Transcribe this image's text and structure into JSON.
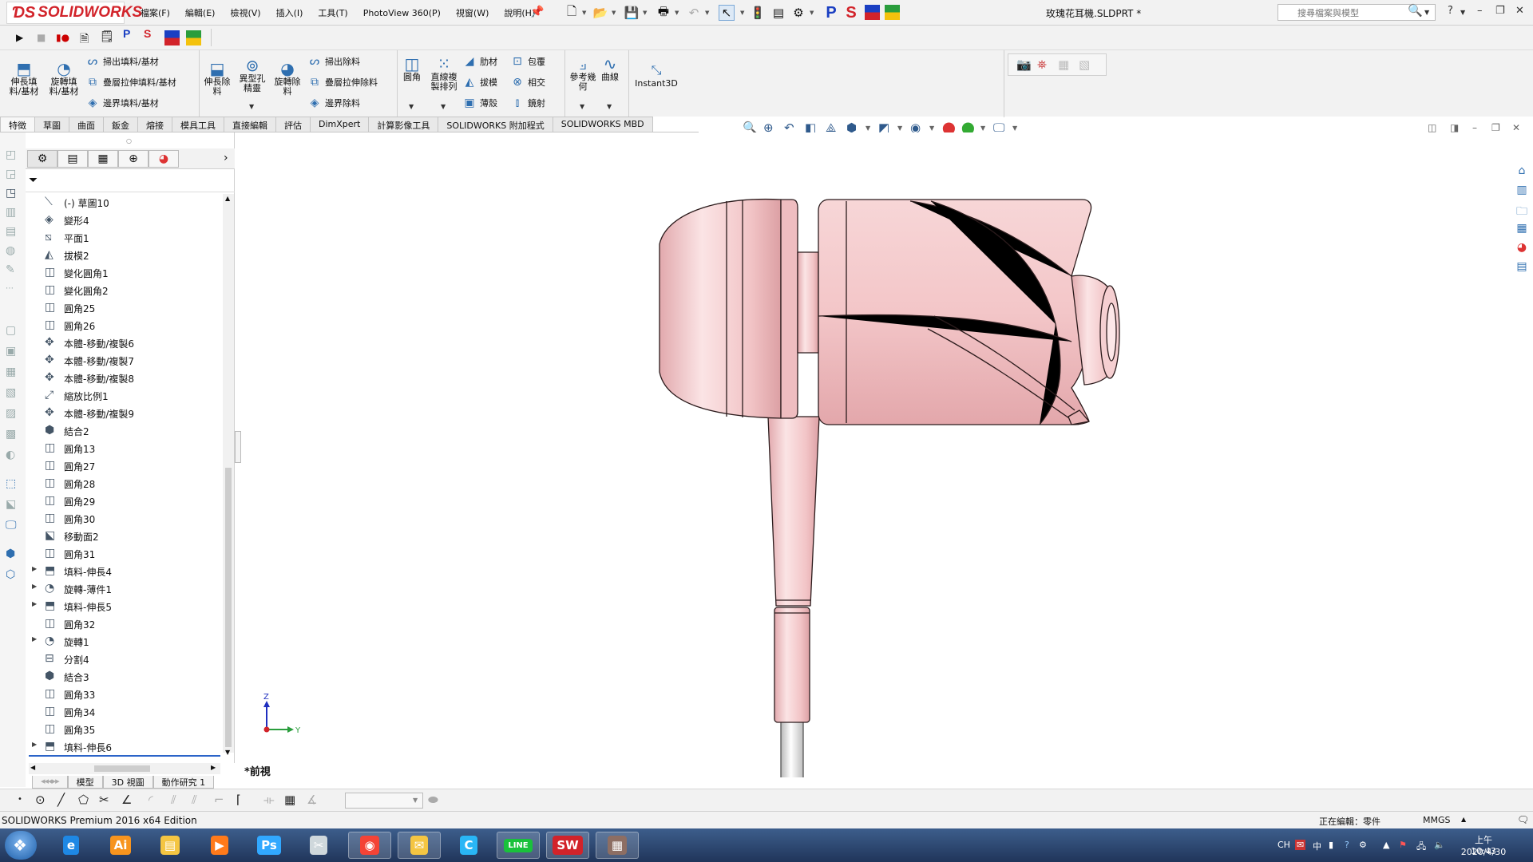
{
  "app": {
    "logo_text": "SOLIDWORKS",
    "document_title": "玫瑰花耳機.SLDPRT *",
    "search_placeholder": "搜尋檔案與模型"
  },
  "menu": [
    "檔案(F)",
    "編輯(E)",
    "檢視(V)",
    "插入(I)",
    "工具(T)",
    "PhotoView 360(P)",
    "視窗(W)",
    "說明(H)"
  ],
  "macro_bar": {
    "p_label": "P",
    "s_label": "S"
  },
  "command_manager": {
    "features": {
      "extruded_boss": "伸長填\n料/基材",
      "revolved_boss": "旋轉填\n料/基材",
      "swept_boss": "掃出填料/基材",
      "lofted_boss": "疊層拉伸填料/基材",
      "boundary_boss": "邊界填料/基材",
      "extruded_cut": "伸長除\n料",
      "hole_wizard": "異型孔\n精靈",
      "revolved_cut": "旋轉除\n料",
      "swept_cut": "掃出除料",
      "lofted_cut": "疊層拉伸除料",
      "boundary_cut": "邊界除料",
      "fillet": "圓角",
      "linear_pattern": "直線複\n製排列",
      "rib": "肋材",
      "draft": "拔模",
      "shell": "薄殼",
      "wrap": "包覆",
      "intersect": "相交",
      "mirror": "鏡射",
      "reference_geometry": "參考幾\n何",
      "curves": "曲線",
      "instant3d": "Instant3D"
    }
  },
  "tabs": [
    "特徵",
    "草圖",
    "曲面",
    "鈑金",
    "熔接",
    "模具工具",
    "直接編輯",
    "評估",
    "DimXpert",
    "計算影像工具",
    "SOLIDWORKS 附加程式",
    "SOLIDWORKS MBD"
  ],
  "active_tab": "特徵",
  "feature_tree": [
    {
      "label": "(-) 草圖10",
      "icon": "sketch-icon",
      "expandable": false
    },
    {
      "label": "變形4",
      "icon": "deform-icon",
      "expandable": false
    },
    {
      "label": "平面1",
      "icon": "plane-icon",
      "expandable": false
    },
    {
      "label": "拔模2",
      "icon": "draft-icon",
      "expandable": false
    },
    {
      "label": "變化圓角1",
      "icon": "fillet-icon",
      "expandable": false
    },
    {
      "label": "變化圓角2",
      "icon": "fillet-icon",
      "expandable": false
    },
    {
      "label": "圓角25",
      "icon": "fillet-icon",
      "expandable": false
    },
    {
      "label": "圓角26",
      "icon": "fillet-icon",
      "expandable": false
    },
    {
      "label": "本體-移動/複製6",
      "icon": "move-body-icon",
      "expandable": false
    },
    {
      "label": "本體-移動/複製7",
      "icon": "move-body-icon",
      "expandable": false
    },
    {
      "label": "本體-移動/複製8",
      "icon": "move-body-icon",
      "expandable": false
    },
    {
      "label": "縮放比例1",
      "icon": "scale-icon",
      "expandable": false
    },
    {
      "label": "本體-移動/複製9",
      "icon": "move-body-icon",
      "expandable": false
    },
    {
      "label": "結合2",
      "icon": "combine-icon",
      "expandable": false
    },
    {
      "label": "圓角13",
      "icon": "fillet-icon",
      "expandable": false
    },
    {
      "label": "圓角27",
      "icon": "fillet-icon",
      "expandable": false
    },
    {
      "label": "圓角28",
      "icon": "fillet-icon",
      "expandable": false
    },
    {
      "label": "圓角29",
      "icon": "fillet-icon",
      "expandable": false
    },
    {
      "label": "圓角30",
      "icon": "fillet-icon",
      "expandable": false
    },
    {
      "label": "移動面2",
      "icon": "move-face-icon",
      "expandable": false
    },
    {
      "label": "圓角31",
      "icon": "fillet-icon",
      "expandable": false
    },
    {
      "label": "填料-伸長4",
      "icon": "extrude-icon",
      "expandable": true
    },
    {
      "label": "旋轉-薄件1",
      "icon": "revolve-icon",
      "expandable": true
    },
    {
      "label": "填料-伸長5",
      "icon": "extrude-icon",
      "expandable": true
    },
    {
      "label": "圓角32",
      "icon": "fillet-icon",
      "expandable": false
    },
    {
      "label": "旋轉1",
      "icon": "revolve-icon",
      "expandable": true
    },
    {
      "label": "分割4",
      "icon": "split-icon",
      "expandable": false
    },
    {
      "label": "結合3",
      "icon": "combine-icon",
      "expandable": false
    },
    {
      "label": "圓角33",
      "icon": "fillet-icon",
      "expandable": false
    },
    {
      "label": "圓角34",
      "icon": "fillet-icon",
      "expandable": false
    },
    {
      "label": "圓角35",
      "icon": "fillet-icon",
      "expandable": false
    },
    {
      "label": "填料-伸長6",
      "icon": "extrude-icon",
      "expandable": true
    }
  ],
  "model_tabs": [
    "模型",
    "3D 視圖",
    "動作研究 1"
  ],
  "viewport": {
    "view_name": "*前視",
    "triad_z": "Z",
    "triad_y": "Y",
    "model_color": "#f2c4c6"
  },
  "status_bar": {
    "product": "SOLIDWORKS Premium 2016 x64 Edition",
    "editing": "正在編輯：零件",
    "units": "MMGS"
  },
  "taskbar": {
    "apps": [
      {
        "name": "ie",
        "label": "e",
        "color": "#1e88e5"
      },
      {
        "name": "illustrator",
        "label": "Ai",
        "color": "#f7941e"
      },
      {
        "name": "explorer",
        "label": "▤",
        "color": "#f4c542"
      },
      {
        "name": "media-player",
        "label": "▶",
        "color": "#ff7a1a"
      },
      {
        "name": "photoshop",
        "label": "Ps",
        "color": "#31a8ff"
      },
      {
        "name": "snipping",
        "label": "✂",
        "color": "#cfd8dc"
      },
      {
        "name": "chrome",
        "label": "◉",
        "color": "#f44336"
      },
      {
        "name": "mail",
        "label": "✉",
        "color": "#f4c542"
      },
      {
        "name": "c-app",
        "label": "C",
        "color": "#29b6f6"
      },
      {
        "name": "line",
        "label": "LINE",
        "color": "#19c13b"
      },
      {
        "name": "solidworks",
        "label": "SW",
        "color": "#d2232a"
      },
      {
        "name": "image-viewer",
        "label": "▦",
        "color": "#8d6e63"
      }
    ],
    "tray_lang": "CH",
    "tray_ime": "中",
    "clock_time": "上午 10:43",
    "clock_date": "2020/4/30"
  }
}
